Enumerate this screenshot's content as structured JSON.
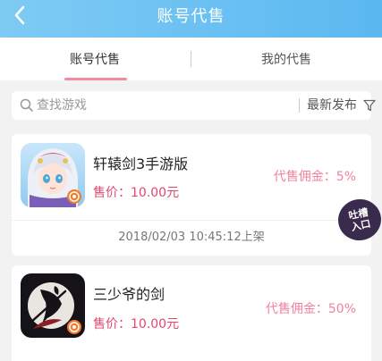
{
  "header": {
    "title": "账号代售"
  },
  "tabs": [
    {
      "label": "账号代售",
      "active": true
    },
    {
      "label": "我的代售",
      "active": false
    }
  ],
  "search": {
    "placeholder": "查找游戏",
    "sort_label": "最新发布"
  },
  "listings": [
    {
      "name": "轩辕剑3手游版",
      "price": "售价：10.00元",
      "commission": "代售佣金：5%",
      "timestamp": "2018/02/03 10:45:12上架",
      "icon": "anime-girl-game-icon"
    },
    {
      "name": "三少爷的剑",
      "price": "售价：10.00元",
      "commission": "代售佣金：50%",
      "icon": "swordsman-game-icon"
    }
  ],
  "float_badge": {
    "line1": "吐槽",
    "line2": "入口"
  },
  "colors": {
    "header": "#6cc1f2",
    "accent_pink": "#f48aa0",
    "price_red": "#e4476a"
  }
}
